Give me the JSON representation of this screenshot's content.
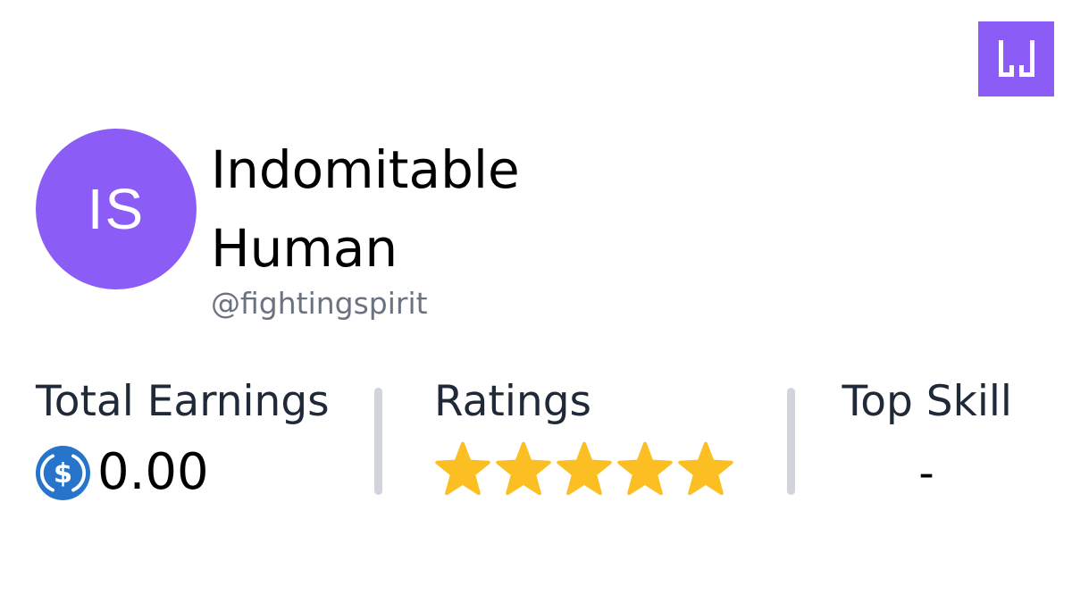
{
  "brand": {
    "logo_icon": "w-pixel-logo-icon",
    "color": "#8b5cf6"
  },
  "profile": {
    "avatar_initials": "IS",
    "avatar_color": "#8b5cf6",
    "name_line1": "Indomitable",
    "name_line2": "Human",
    "handle": "@fightingspirit"
  },
  "stats": {
    "earnings": {
      "label": "Total Earnings",
      "value": "0.00",
      "currency_icon": "usdc-coin-icon",
      "icon_color": "#2775ca"
    },
    "ratings": {
      "label": "Ratings",
      "stars_filled": 5,
      "stars_total": 5,
      "star_color": "#fbbf24"
    },
    "top_skill": {
      "label": "Top Skill",
      "value": "-"
    }
  }
}
